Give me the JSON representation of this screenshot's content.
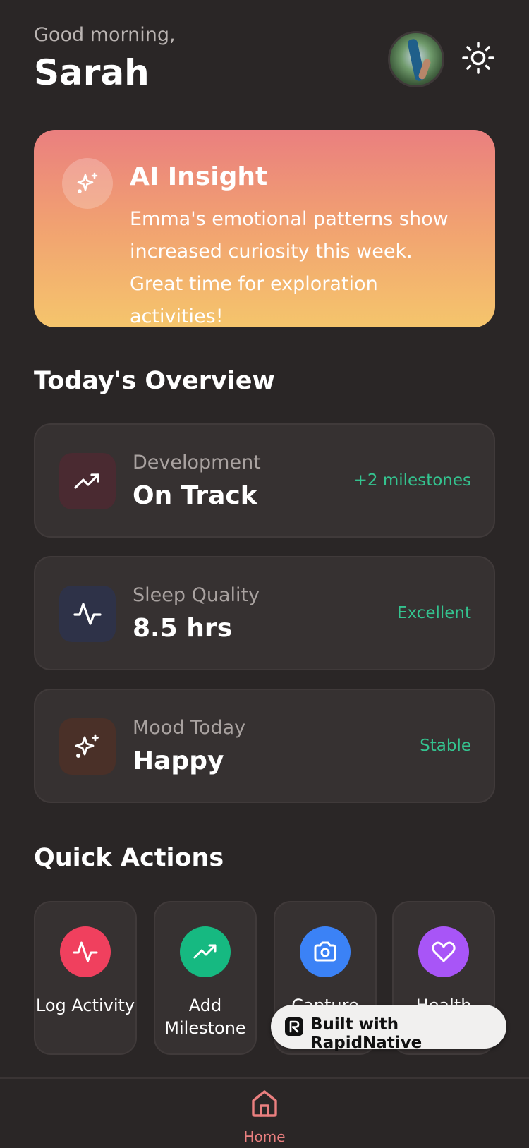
{
  "header": {
    "greeting": "Good morning,",
    "user_name": "Sarah"
  },
  "insight": {
    "title": "AI Insight",
    "body": "Emma's emotional patterns show increased curiosity this week. Great time for exploration activities!"
  },
  "overview": {
    "title": "Today's Overview",
    "cards": [
      {
        "label": "Development",
        "value": "On Track",
        "status": "+2 milestones",
        "icon": "trending-up-icon",
        "icon_bg": "#4a2a31"
      },
      {
        "label": "Sleep Quality",
        "value": "8.5 hrs",
        "status": "Excellent",
        "icon": "activity-icon",
        "icon_bg": "#2e3248"
      },
      {
        "label": "Mood Today",
        "value": "Happy",
        "status": "Stable",
        "icon": "sparkles-icon",
        "icon_bg": "#4a3028"
      }
    ]
  },
  "quick_actions": {
    "title": "Quick Actions",
    "items": [
      {
        "label": "Log Activity",
        "icon": "activity-icon",
        "color": "#f0405e"
      },
      {
        "label": "Add Milestone",
        "icon": "trending-up-icon",
        "color": "#16b981"
      },
      {
        "label": "Capture",
        "icon": "camera-icon",
        "color": "#3b82f6"
      },
      {
        "label": "Health",
        "icon": "heart-icon",
        "color": "#a855f7"
      }
    ]
  },
  "badge": {
    "text": "Built with RapidNative"
  },
  "tabbar": {
    "home_label": "Home",
    "active_color": "#ea7f7f"
  },
  "colors": {
    "background": "#2a2626",
    "card": "#363131",
    "success": "#34c38f"
  }
}
